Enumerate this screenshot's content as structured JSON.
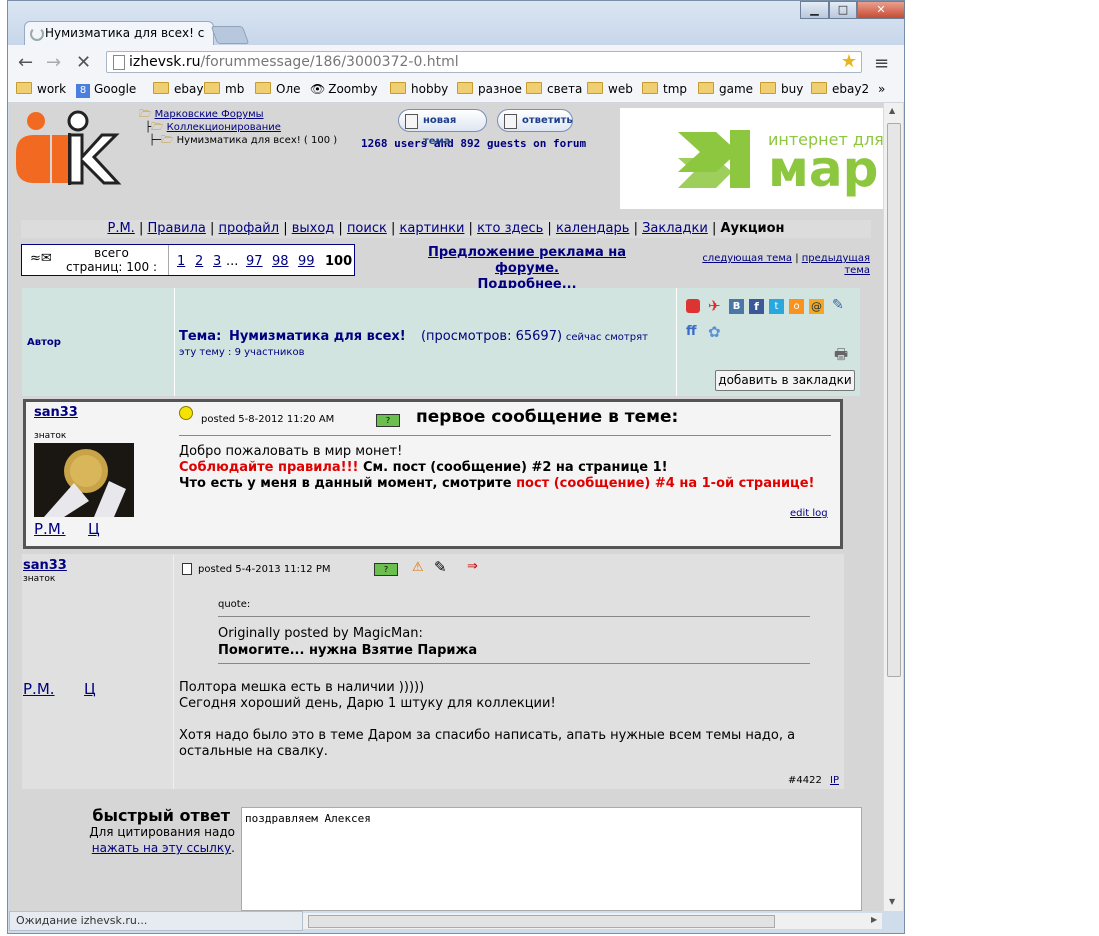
{
  "browser": {
    "tab_title": "Нумизматика для всех! с",
    "url_domain": "izhevsk.ru",
    "url_path": "/forummessage/186/3000372-0.html",
    "status_text": "Ожидание izhevsk.ru...",
    "bookmarks": [
      "work",
      "Google",
      "ebay",
      "mb",
      "Оле",
      "Zoomby",
      "hobby",
      "разное",
      "света",
      "web",
      "tmp",
      "game",
      "buy",
      "ebay2"
    ],
    "bookmarks_more": "»"
  },
  "header": {
    "crumb1": "Марковские Форумы",
    "crumb2": "Коллекционирование",
    "crumb3": "Нумизматика для всех! ( 100 )",
    "online": "1268 users and 892 guests on forum",
    "new_topic": "новая тема",
    "reply": "ответить",
    "ad_top": "интернет для",
    "ad_big": "мар"
  },
  "topnav": [
    "Р.М.",
    "Правила",
    "профайл",
    "выход",
    "поиск",
    "картинки",
    "кто здесь",
    "календарь",
    "Закладки",
    "Аукцион"
  ],
  "pager": {
    "label1": "всего",
    "label2": "страниц: 100 :",
    "pages": [
      "1",
      "2",
      "3",
      "...",
      "97",
      "98",
      "99"
    ],
    "current": "100"
  },
  "promo": {
    "line1": "Предложение реклама на форуме.",
    "line2": "Подробнее..."
  },
  "thread_nav": {
    "next": "следующая тема",
    "sep": "|",
    "prev": "предыдущая тема"
  },
  "thread": {
    "author_label": "Автор",
    "topic_label": "Тема:",
    "topic_title": "Нумизматика для всех!",
    "views": "(просмотров: 65697)",
    "watching1": "сейчас смотрят",
    "watching2": "эту тему : 9 участников",
    "bookmark_btn": "добавить в закладки"
  },
  "post1": {
    "author": "san33",
    "rank": "знаток",
    "posted": "posted 5-8-2012 11:20 AM",
    "first_label": "первое сообщение в теме:",
    "line1": "Добро пожаловать в мир монет!",
    "line2_red": "Соблюдайте правила!!!",
    "line2_black": " См. пост (сообщение) #2 на странице 1!",
    "line3_black": "Что есть у меня в данный момент, смотрите ",
    "line3_red": "пост (сообщение) #4 на 1-ой странице!",
    "edit_log": "edit log",
    "link_rm": "Р.М.",
    "link_c": "Ц"
  },
  "post2": {
    "author": "san33",
    "rank": "знаток",
    "posted": "posted 5-4-2013 11:12 PM",
    "quote_label": "quote:",
    "quote_by": "Originally posted by MagicMan:",
    "quote_text": "Помогите... нужна Взятие Парижа",
    "body1": "Полтора мешка есть в наличии )))))",
    "body2": "Сегодня хороший день, Дарю 1 штуку для коллекции!",
    "body3": "Хотя надо было это в теме Даром за спасибо написать, апать нужные всем темы надо, а",
    "body4": "остальные на свалку.",
    "post_no": "#4422",
    "ip": "IP",
    "link_rm": "Р.М.",
    "link_c": "Ц"
  },
  "quick_reply": {
    "title": "быстрый ответ",
    "hint": "Для цитирования надо",
    "link": "нажать на эту ссылку",
    "dot": ".",
    "text": "поздравляем Алексея"
  },
  "colors": {
    "link": "#000080",
    "red": "#e00000",
    "header_bg": "#d2e4e0",
    "logo_orange": "#f26a21",
    "ad_green": "#8dc63f"
  }
}
